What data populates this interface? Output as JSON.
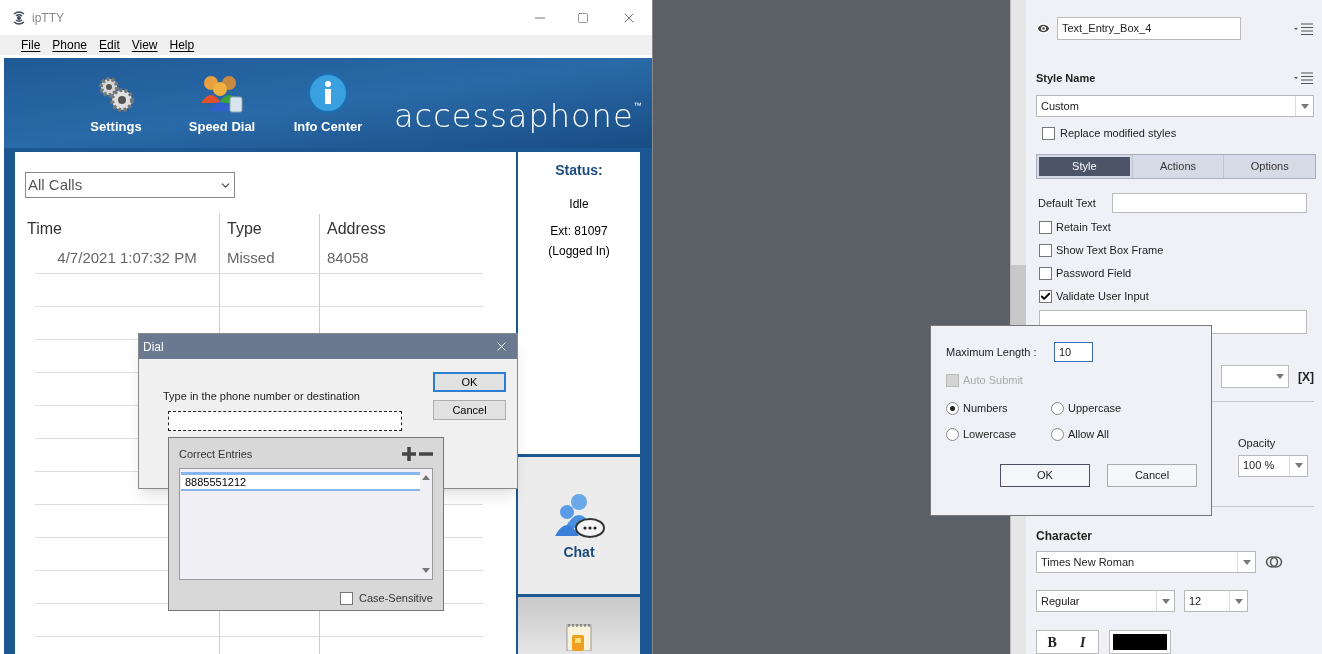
{
  "app_window": {
    "title": "ipTTY",
    "menu": [
      "File",
      "Phone",
      "Edit",
      "View",
      "Help"
    ],
    "toolbar": [
      {
        "label": "Settings",
        "kind": "gears"
      },
      {
        "label": "Speed Dial",
        "kind": "people"
      },
      {
        "label": "Info Center",
        "kind": "info"
      }
    ],
    "logo": "accessaphone",
    "logo_mark": "™"
  },
  "calls": {
    "filter": "All Calls",
    "columns": [
      "Time",
      "Type",
      "Address"
    ],
    "rows": [
      [
        "4/7/2021 1:07:32 PM",
        "Missed",
        "84058"
      ]
    ]
  },
  "status": {
    "heading": "Status:",
    "state": "Idle",
    "extension": "Ext: 81097",
    "login": "(Logged In)"
  },
  "side_buttons": [
    {
      "label": "Chat",
      "kind": "chat"
    },
    {
      "kind": "notepad"
    }
  ],
  "dial_dialog": {
    "title": "Dial",
    "prompt": "Type in the phone number or destination",
    "buttons": [
      {
        "label": "OK",
        "selected": true
      },
      {
        "label": "Cancel",
        "selected": false
      }
    ]
  },
  "correct_entries": {
    "title": "Correct Entries",
    "entries": [
      "8885551212"
    ],
    "case_sensitive": {
      "label": "Case-Sensitive",
      "checked": false
    }
  },
  "properties": {
    "name": "Text_Entry_Box_4",
    "style_name_label": "Style Name",
    "style": "Custom",
    "replace_modified": {
      "label": "Replace modified styles",
      "checked": false
    },
    "tabs": [
      {
        "label": "Style",
        "selected": true
      },
      {
        "label": "Actions",
        "selected": false
      },
      {
        "label": "Options",
        "selected": false
      }
    ],
    "default_text_label": "Default Text",
    "options": [
      {
        "label": "Retain Text",
        "checked": false
      },
      {
        "label": "Show Text Box Frame",
        "checked": false
      },
      {
        "label": "Password Field",
        "checked": false
      },
      {
        "label": "Validate User Input",
        "checked": true
      }
    ],
    "clear_label": "[X]",
    "opacity_label": "Opacity",
    "opacity": "100 %",
    "character_label": "Character",
    "font": "Times New Roman",
    "font_style": "Regular",
    "font_size": "12",
    "format_buttons": [
      "B",
      "I"
    ]
  },
  "options_dialog": {
    "max_length_label": "Maximum Length :",
    "max_length": "10",
    "auto_submit": {
      "label": "Auto Submit",
      "checked": false,
      "disabled": true
    },
    "input_types": [
      {
        "label": "Numbers",
        "selected": true
      },
      {
        "label": "Uppercase",
        "selected": false
      },
      {
        "label": "Lowercase",
        "selected": false
      },
      {
        "label": "Allow All",
        "selected": false
      }
    ],
    "buttons": [
      "OK",
      "Cancel"
    ]
  }
}
